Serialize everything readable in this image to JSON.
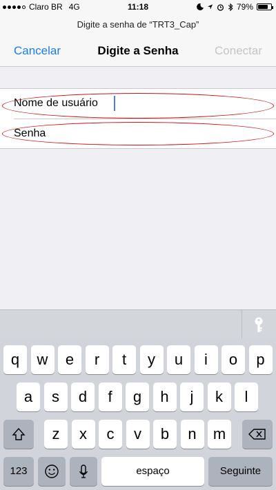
{
  "status_bar": {
    "carrier": "Claro BR",
    "network": "4G",
    "time": "11:18",
    "battery": "79%",
    "battery_level": 0.79,
    "icons": [
      "signal-dots",
      "moon-icon",
      "location-arrow-icon",
      "alarm-clock-icon",
      "bluetooth-icon",
      "battery-icon"
    ]
  },
  "header": {
    "prompt": "Digite a senha de “TRT3_Cap”",
    "title": "Digite a Senha",
    "cancel_label": "Cancelar",
    "connect_label": "Conectar"
  },
  "form": {
    "username_label": "Nome de usuário",
    "username_value": "",
    "password_label": "Senha",
    "password_value": ""
  },
  "keyboard": {
    "accessory_icon": "key-icon",
    "row1": [
      "q",
      "w",
      "e",
      "r",
      "t",
      "y",
      "u",
      "i",
      "o",
      "p"
    ],
    "row2": [
      "a",
      "s",
      "d",
      "f",
      "g",
      "h",
      "j",
      "k",
      "l"
    ],
    "row3": [
      "z",
      "x",
      "c",
      "v",
      "b",
      "n",
      "m"
    ],
    "numbers_label": "123",
    "space_label": "espaço",
    "return_label": "Seguinte"
  },
  "colors": {
    "accent": "#1a7cf5",
    "disabled": "#c4c4c8",
    "highlight": "#d40e0e",
    "cursor": "#4a7cf0"
  }
}
